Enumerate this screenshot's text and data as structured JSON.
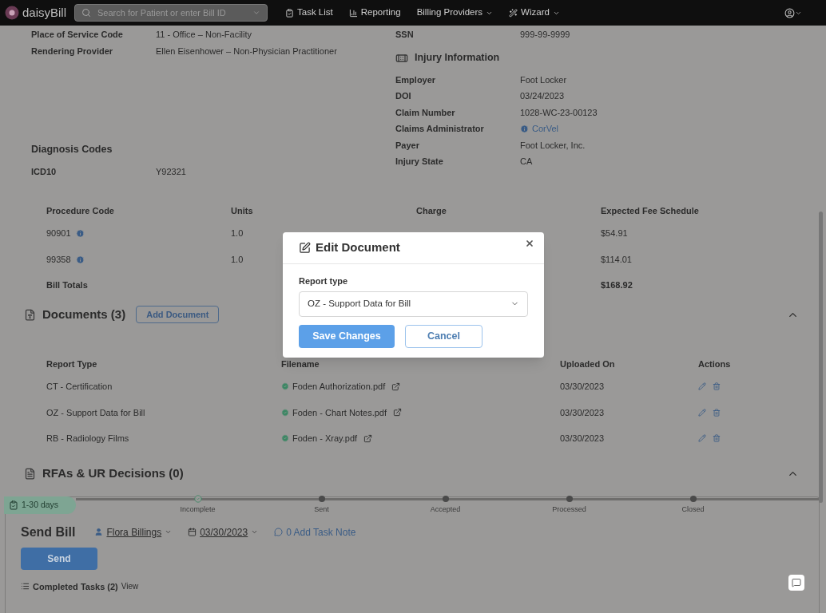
{
  "navbar": {
    "logo": "daisyBill",
    "search": {
      "placeholder": "Search for Patient or enter Bill ID"
    },
    "items": [
      {
        "label": "Task List",
        "dropdown": false
      },
      {
        "label": "Reporting",
        "dropdown": false
      },
      {
        "label": "Billing Providers",
        "dropdown": true
      },
      {
        "label": "Wizard",
        "dropdown": true
      }
    ]
  },
  "bill_info": {
    "left": [
      {
        "label": "Place of Service Code",
        "value": "11 - Office – Non-Facility"
      },
      {
        "label": "Rendering Provider",
        "value": "Ellen Eisenhower – Non-Physician Practitioner"
      }
    ],
    "right": [
      {
        "label": "SSN",
        "value": "999-99-9999"
      }
    ]
  },
  "injury_information": {
    "title": "Injury Information",
    "fields": [
      {
        "label": "Employer",
        "value": "Foot Locker",
        "kind": "text"
      },
      {
        "label": "DOI",
        "value": "03/24/2023",
        "kind": "text"
      },
      {
        "label": "Claim Number",
        "value": "1028-WC-23-00123",
        "kind": "text"
      },
      {
        "label": "Claims Administrator",
        "value": "CorVel",
        "kind": "link"
      },
      {
        "label": "Payer",
        "value": "Foot Locker, Inc.",
        "kind": "text"
      },
      {
        "label": "Injury State",
        "value": "CA",
        "kind": "text"
      }
    ]
  },
  "diagnosis_codes": {
    "title": "Diagnosis Codes",
    "rows": [
      {
        "type": "ICD10",
        "code": "Y92321"
      }
    ]
  },
  "procedures": {
    "columns": [
      "Procedure Code",
      "Units",
      "Charge",
      "Expected Fee Schedule"
    ],
    "rows": [
      {
        "code": "90901",
        "units": "1.0",
        "expected": "$54.91"
      },
      {
        "code": "99358",
        "units": "1.0",
        "expected": "$114.01"
      }
    ],
    "totals": {
      "label": "Bill Totals",
      "expected": "$168.92"
    }
  },
  "documents": {
    "title": "Documents (3)",
    "add_button": "Add Document",
    "expanded": true,
    "columns": [
      "Report Type",
      "Filename",
      "Uploaded On",
      "Actions"
    ],
    "rows": [
      {
        "report_type": "CT - Certification",
        "filename": "Foden Authorization.pdf",
        "uploaded_on": "03/30/2023"
      },
      {
        "report_type": "OZ - Support Data for Bill",
        "filename": "Foden - Chart Notes.pdf",
        "uploaded_on": "03/30/2023"
      },
      {
        "report_type": "RB - Radiology Films",
        "filename": "Foden - Xray.pdf",
        "uploaded_on": "03/30/2023"
      }
    ]
  },
  "rfas": {
    "title": "RFAs & UR Decisions (0)",
    "expanded": true
  },
  "task": {
    "badge": "1-30 days",
    "steps": [
      {
        "label": "Incomplete",
        "done": true
      },
      {
        "label": "Sent",
        "done": false
      },
      {
        "label": "Accepted",
        "done": false
      },
      {
        "label": "Processed",
        "done": false
      },
      {
        "label": "Closed",
        "done": false
      }
    ],
    "title": "Send Bill",
    "assignee": "Flora Billings",
    "date": "03/30/2023",
    "note": "0 Add Task Note",
    "send_button": "Send",
    "completed": "Completed Tasks (2)",
    "view": "View"
  },
  "modal": {
    "title": "Edit Document",
    "field_label": "Report type",
    "select_value": "OZ - Support Data for Bill",
    "save_button": "Save Changes",
    "cancel_button": "Cancel"
  }
}
